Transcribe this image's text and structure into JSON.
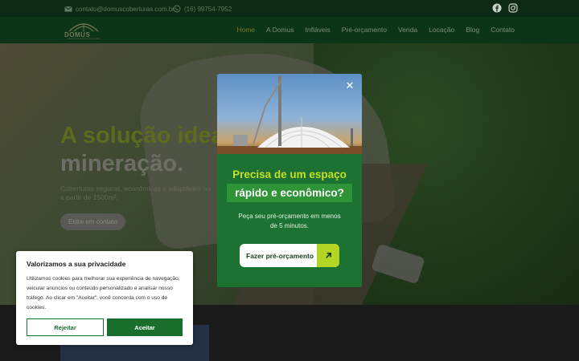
{
  "topbar": {
    "email": "contato@domuscoberturas.com.br",
    "phone": "(16) 99754-7952",
    "email_icon": "envelope-icon",
    "phone_icon": "whatsapp-icon",
    "social": [
      "facebook-icon",
      "instagram-icon"
    ]
  },
  "nav": {
    "logo_text": "DOMUS",
    "items": [
      "Home",
      "A Domus",
      "Infláveis",
      "Pré-orçamento",
      "Venda",
      "Locação",
      "Blog",
      "Contato"
    ],
    "active": "Home"
  },
  "hero": {
    "title_line1": "A solução idea",
    "title_line2": "mineração.",
    "subtitle_line1": "Coberturas seguras, econômicas e adaptáveis ao",
    "subtitle_line2": "a partir de 1500m².",
    "cta": "Entre em contato"
  },
  "popup": {
    "title": "Precisa de um espaço",
    "highlight": "rápido e econômico?",
    "description": "Peça seu pré-orçamento em menos de 5 minutos.",
    "button": "Fazer pré-orçamento",
    "close_icon": "close-icon",
    "arrow_icon": "arrow-up-right-icon"
  },
  "cookie": {
    "title": "Valorizamos a sua privacidade",
    "text": "Utilizamos cookies para melhorar sua experiência de navegação, veicular anúncios ou conteúdo personalizado e analisar nosso tráfego. Ao clicar em \"Aceitar\", você concorda com o uso de cookies.",
    "reject": "Rejeitar",
    "accept": "Aceitar"
  },
  "colors": {
    "brand_green": "#1b7232",
    "accent_lime": "#c7df2a",
    "dark_green": "#0c3416"
  }
}
